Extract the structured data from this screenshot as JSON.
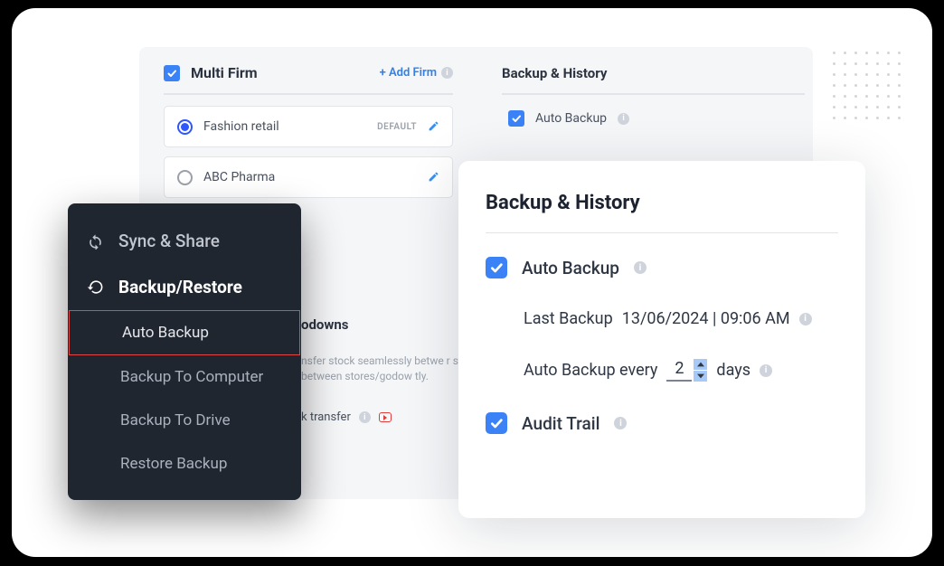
{
  "multiFirm": {
    "title": "Multi Firm",
    "addFirm": "+ Add Firm",
    "firms": [
      {
        "name": "Fashion retail",
        "default": true,
        "selected": true,
        "defaultLabel": "DEFAULT"
      },
      {
        "name": "ABC Pharma",
        "default": false,
        "selected": false
      }
    ]
  },
  "backupSmall": {
    "title": "Backup & History",
    "autoBackup": "Auto Backup"
  },
  "sidebar": {
    "sync": "Sync & Share",
    "backupRestore": "Backup/Restore",
    "items": [
      "Auto Backup",
      "Backup To Computer",
      "Backup To Drive",
      "Restore Backup"
    ]
  },
  "godown": {
    "title": "odowns",
    "desc": "nsfer stock seamlessly betwe r stock between stores/godow tly.",
    "transfer": "k transfer"
  },
  "bhCard": {
    "title": "Backup & History",
    "autoBackup": "Auto Backup",
    "lastBackupLabel": "Last Backup",
    "lastBackupValue": "13/06/2024 | 09:06 AM",
    "everyPrefix": "Auto Backup every",
    "everyValue": "2",
    "everySuffix": "days",
    "auditTrail": "Audit Trail"
  }
}
